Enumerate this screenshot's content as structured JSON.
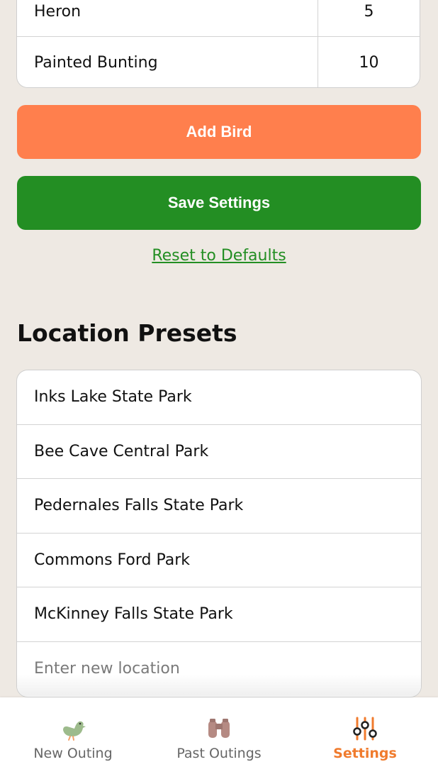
{
  "bird_table": {
    "rows": [
      {
        "name": "Heron",
        "count": "5"
      },
      {
        "name": "Painted Bunting",
        "count": "10"
      }
    ]
  },
  "actions": {
    "add_bird_label": "Add Bird",
    "save_label": "Save Settings",
    "reset_label": "Reset to Defaults"
  },
  "locations": {
    "title": "Location Presets",
    "items": [
      "Inks Lake State Park",
      "Bee Cave Central Park",
      "Pedernales Falls State Park",
      "Commons Ford Park",
      "McKinney Falls State Park"
    ],
    "new_placeholder": "Enter new location"
  },
  "tabs": [
    {
      "label": "New Outing",
      "icon": "bird-icon"
    },
    {
      "label": "Past Outings",
      "icon": "binoculars-icon"
    },
    {
      "label": "Settings",
      "icon": "sliders-icon",
      "active": true
    }
  ],
  "colors": {
    "background": "#EEE9E3",
    "add_button": "#FF7F4D",
    "save_button": "#238E23",
    "active_tab": "#F07B2D"
  }
}
